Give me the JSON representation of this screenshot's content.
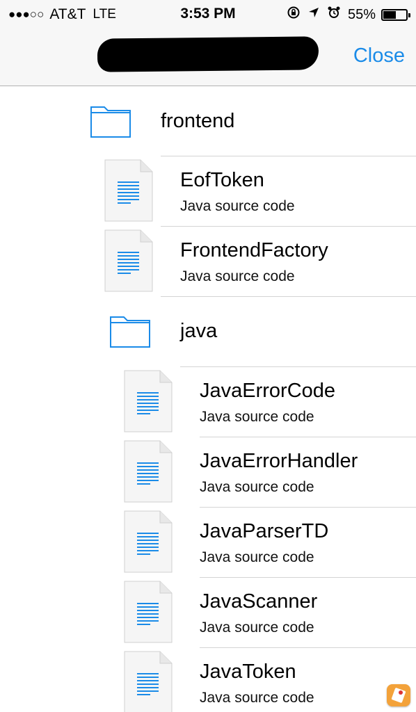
{
  "status_bar": {
    "signal": "●●●○○",
    "carrier": "AT&T",
    "network": "LTE",
    "time": "3:53 PM",
    "rotation_lock_icon": "rotation-lock-icon",
    "location_icon": "location-arrow-icon",
    "alarm_icon": "alarm-clock-icon",
    "battery_percent_text": "55%",
    "battery_level": 0.55
  },
  "nav": {
    "close_label": "Close",
    "accent_color": "#1a8be8"
  },
  "list": {
    "folder_frontend": "frontend",
    "file_eoftoken_name": "EofToken",
    "file_eoftoken_type": "Java source code",
    "file_frontendfactory_name": "FrontendFactory",
    "file_frontendfactory_type": "Java source code",
    "folder_java": "java",
    "file_javaerrorcode_name": "JavaErrorCode",
    "file_javaerrorcode_type": "Java source code",
    "file_javaerrorhandler_name": "JavaErrorHandler",
    "file_javaerrorhandler_type": "Java source code",
    "file_javaparsertd_name": "JavaParserTD",
    "file_javaparsertd_type": "Java source code",
    "file_javascanner_name": "JavaScanner",
    "file_javascanner_type": "Java source code",
    "file_javatoken_name": "JavaToken",
    "file_javatoken_type": "Java source code"
  }
}
